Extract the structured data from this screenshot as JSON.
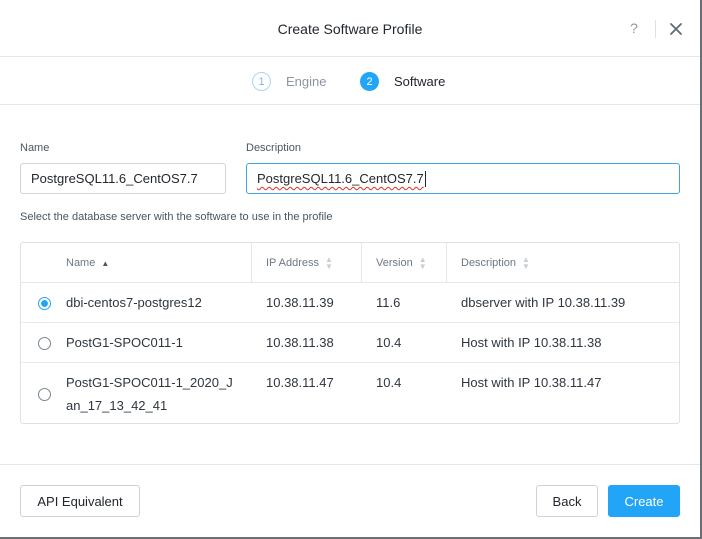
{
  "dialog": {
    "title": "Create Software Profile",
    "help_label": "?",
    "close_icon": "close-icon"
  },
  "steps": [
    {
      "number": "1",
      "label": "Engine",
      "active": false
    },
    {
      "number": "2",
      "label": "Software",
      "active": true
    }
  ],
  "form": {
    "name_label": "Name",
    "name_value": "PostgreSQL11.6_CentOS7.7",
    "description_label": "Description",
    "description_value": "PostgreSQL11.6_CentOS7.7",
    "hint": "Select the database server with the software to use in the profile"
  },
  "table": {
    "columns": [
      {
        "label": "Name",
        "sort": "ascending"
      },
      {
        "label": "IP Address",
        "sort": "none"
      },
      {
        "label": "Version",
        "sort": "none"
      },
      {
        "label": "Description",
        "sort": "none"
      }
    ],
    "rows": [
      {
        "selected": true,
        "name_lines": [
          "dbi-centos7-postgres12"
        ],
        "ip": "10.38.11.39",
        "version": "11.6",
        "description": "dbserver with IP 10.38.11.39"
      },
      {
        "selected": false,
        "name_lines": [
          "PostG1-SPOC011-1"
        ],
        "ip": "10.38.11.38",
        "version": "10.4",
        "description": "Host with IP 10.38.11.38"
      },
      {
        "selected": false,
        "name_lines": [
          "PostG1-SPOC011-1_2020_J",
          "an_17_13_42_41"
        ],
        "ip": "10.38.11.47",
        "version": "10.4",
        "description": "Host with IP 10.38.11.47"
      }
    ]
  },
  "footer": {
    "api_label": "API Equivalent",
    "back_label": "Back",
    "create_label": "Create"
  },
  "colors": {
    "accent": "#22a5f7",
    "text": "#2e3640",
    "muted": "#6d7884",
    "border": "#dde2e6"
  }
}
